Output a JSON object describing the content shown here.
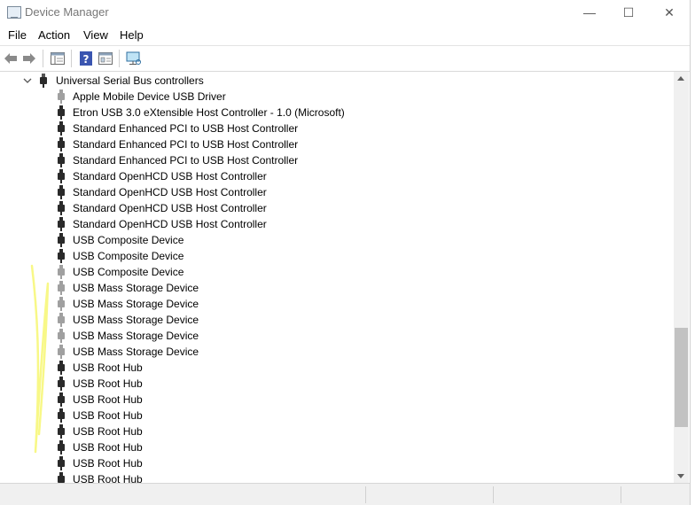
{
  "window": {
    "title": "Device Manager"
  },
  "titlebar": {
    "minimize": "—",
    "maximize": "☐",
    "close": "✕"
  },
  "menu": [
    "File",
    "Action",
    "View",
    "Help"
  ],
  "tree": {
    "category": "Universal Serial Bus controllers",
    "devices": [
      "Apple Mobile Device USB Driver",
      "Etron USB 3.0 eXtensible Host Controller - 1.0 (Microsoft)",
      "Standard Enhanced PCI to USB Host Controller",
      "Standard Enhanced PCI to USB Host Controller",
      "Standard Enhanced PCI to USB Host Controller",
      "Standard OpenHCD USB Host Controller",
      "Standard OpenHCD USB Host Controller",
      "Standard OpenHCD USB Host Controller",
      "Standard OpenHCD USB Host Controller",
      "USB Composite Device",
      "USB Composite Device",
      "USB Composite Device",
      "USB Mass Storage Device",
      "USB Mass Storage Device",
      "USB Mass Storage Device",
      "USB Mass Storage Device",
      "USB Mass Storage Device",
      "USB Root Hub",
      "USB Root Hub",
      "USB Root Hub",
      "USB Root Hub",
      "USB Root Hub",
      "USB Root Hub",
      "USB Root Hub",
      "USB Root Hub"
    ],
    "dimmed_indices": [
      0,
      11,
      12,
      13,
      14,
      15,
      16
    ]
  },
  "colors": {
    "highlight": "#f7f77a",
    "dim_icon": "#a0a0a0",
    "icon": "#2a2a2a"
  }
}
